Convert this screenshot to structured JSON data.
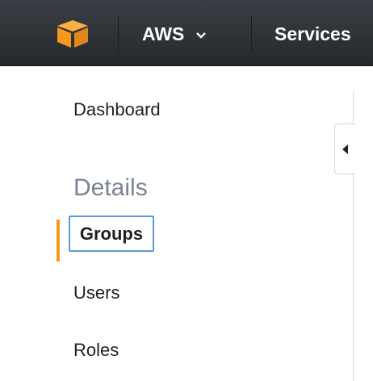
{
  "topbar": {
    "logo_icon": "aws-cube-logo",
    "account_menu_label": "AWS",
    "account_menu_icon": "chevron-down-icon",
    "services_label": "Services",
    "brand_color": "#f7981d"
  },
  "sidebar": {
    "dashboard_label": "Dashboard",
    "section_heading": "Details",
    "items": [
      {
        "label": "Groups",
        "active": true
      },
      {
        "label": "Users",
        "active": false
      },
      {
        "label": "Roles",
        "active": false
      }
    ],
    "active_indicator_color": "#f7981d",
    "focus_outline_color": "#5e9ad3",
    "collapse_icon": "caret-left-icon"
  }
}
